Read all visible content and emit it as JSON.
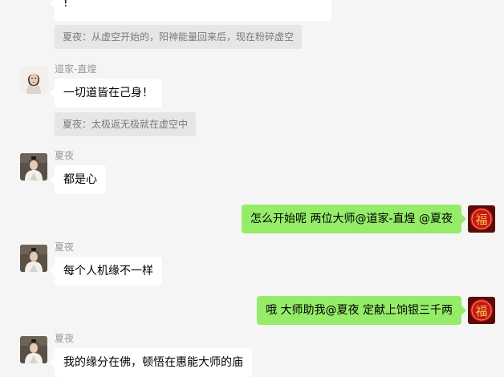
{
  "messages": [
    {
      "type": "incoming",
      "text": "!"
    },
    {
      "type": "quote",
      "text": "夏夜：从虚空开始的，阳神能量回来后，现在粉碎虚空"
    },
    {
      "type": "incoming",
      "sender": "道家-直煌",
      "avatar": "woman-portrait-avatar",
      "text": "一切道皆在己身！"
    },
    {
      "type": "quote",
      "text": "夏夜：太极返无极就在虚空中"
    },
    {
      "type": "incoming",
      "sender": "夏夜",
      "avatar": "costume-portrait-avatar",
      "text": "都是心"
    },
    {
      "type": "outgoing",
      "avatar": "fu-character-avatar",
      "text": "怎么开始呢 两位大师@道家-直煌 @夏夜"
    },
    {
      "type": "incoming",
      "sender": "夏夜",
      "avatar": "costume-portrait-avatar",
      "text": "每个人机缘不一样"
    },
    {
      "type": "outgoing",
      "avatar": "fu-character-avatar",
      "text": "哦  大师助我@夏夜 定献上饷银三千两"
    },
    {
      "type": "incoming",
      "sender": "夏夜",
      "avatar": "costume-portrait-avatar",
      "text": "我的缘分在佛，顿悟在惠能大师的庙"
    }
  ],
  "fu_glyph": "福",
  "colors": {
    "background": "#f5f5f5",
    "incoming_bubble": "#ffffff",
    "outgoing_bubble": "#95ec69",
    "quote_bubble": "#e6e6e6",
    "fu_avatar_red": "#c8161d",
    "fu_avatar_gold": "#f5c242"
  }
}
